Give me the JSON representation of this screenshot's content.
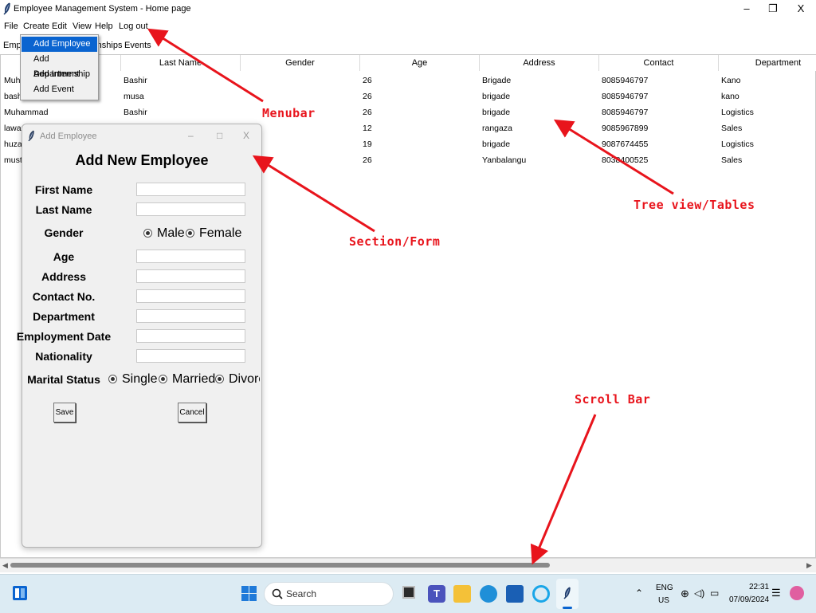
{
  "window": {
    "title": "Employee Management System - Home page",
    "minimize": "–",
    "maximize": "❐",
    "close": "X"
  },
  "menubar": [
    "File",
    "Create",
    "Edit",
    "View",
    "Help",
    "Log out"
  ],
  "tabs": {
    "tab1": "Empl",
    "tab2": "rnships",
    "tab3": "Events"
  },
  "dropdown": [
    "Add Employee",
    "Add Department",
    "Add Internship",
    "Add Event"
  ],
  "table": {
    "headers": [
      "Last Name",
      "Gender",
      "Age",
      "Address",
      "Contact",
      "Department"
    ],
    "rows": [
      [
        "Muh",
        "Bashir",
        "",
        "26",
        "Brigade",
        "8085946797",
        "Kano"
      ],
      [
        "bash",
        "musa",
        "",
        "26",
        "brigade",
        "8085946797",
        "kano"
      ],
      [
        "Muhammad",
        "Bashir",
        "",
        "26",
        "brigade",
        "8085946797",
        "Logistics"
      ],
      [
        "lawan",
        "",
        "",
        "12",
        "rangaza",
        "9085967899",
        "Sales"
      ],
      [
        "huzai",
        "",
        "",
        "19",
        "brigade",
        "9087674455",
        "Logistics"
      ],
      [
        "musta",
        "",
        "",
        "26",
        "Yanbalangu",
        "8038400525",
        "Sales"
      ]
    ]
  },
  "dialog": {
    "title": "Add Employee",
    "heading": "Add New Employee",
    "labels": {
      "first_name": "First Name",
      "last_name": "Last Name",
      "gender": "Gender",
      "age": "Age",
      "address": "Address",
      "contact": "Contact No.",
      "department": "Department",
      "employment_date": "Employment Date",
      "nationality": "Nationality",
      "marital_status": "Marital Status"
    },
    "gender_options": [
      "Male",
      "Female"
    ],
    "marital_options": [
      "Single",
      "Married",
      "Divorc"
    ],
    "save_label": "Save",
    "cancel_label": "Cancel"
  },
  "annotations": {
    "menubar": "Menubar",
    "tree": "Tree view/Tables",
    "form": "Section/Form",
    "scroll": "Scroll Bar"
  },
  "taskbar": {
    "search_placeholder": "Search",
    "lang": "ENG",
    "region": "US",
    "time": "22:31",
    "date": "07/09/2024"
  },
  "colors": {
    "accent": "#0a64d0",
    "annotation": "#e8141c",
    "taskbar": "#dcebf3"
  }
}
